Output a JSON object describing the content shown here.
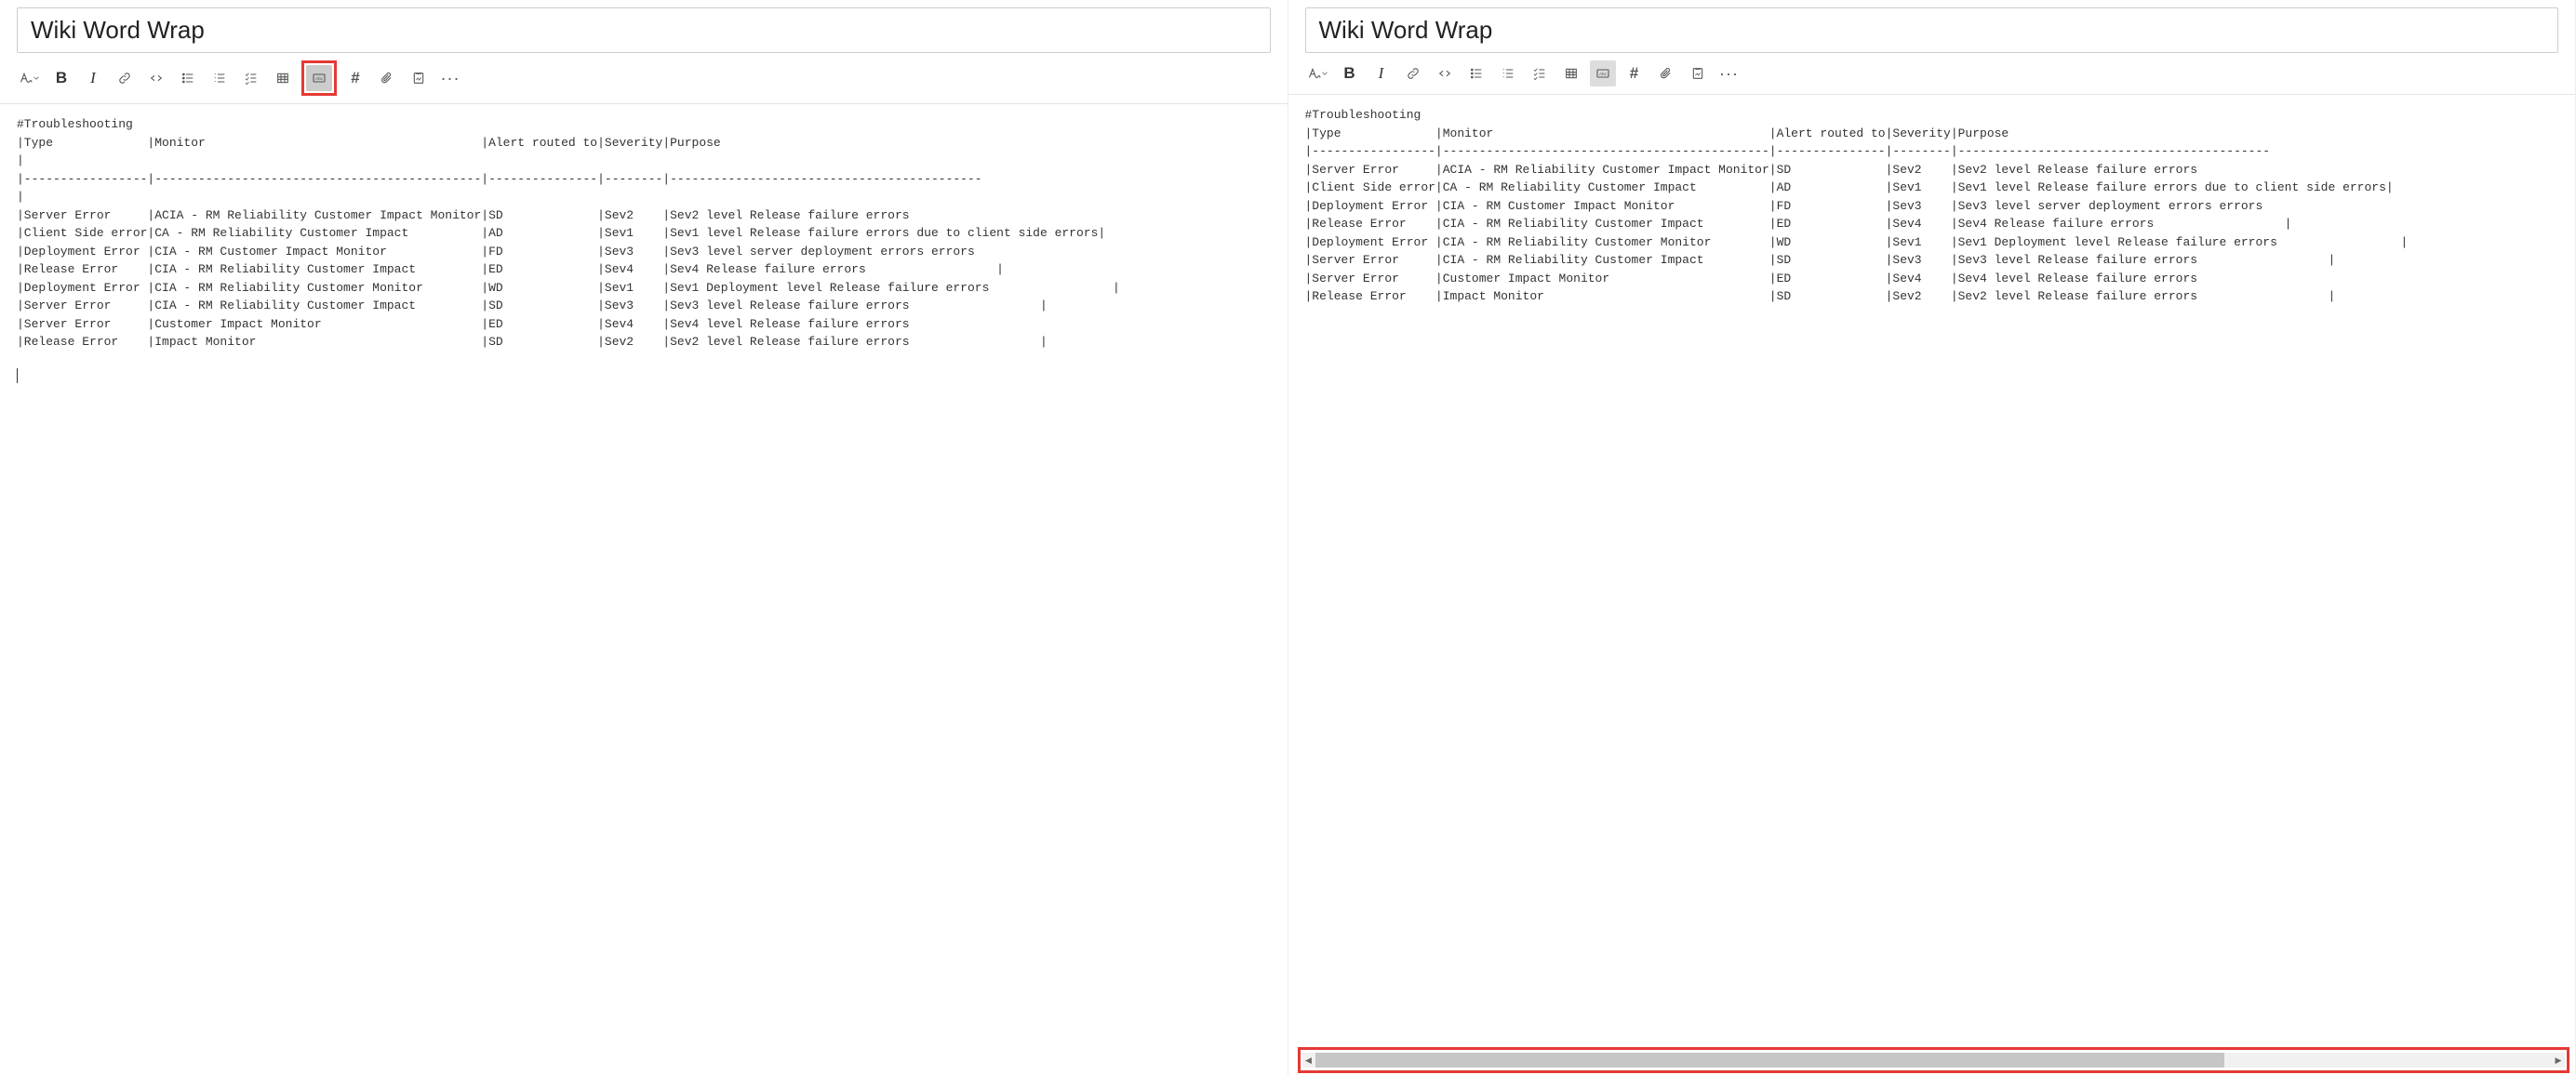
{
  "title": "Wiki Word Wrap",
  "toolbar": {
    "format_dropdown": "A",
    "bold": "B",
    "italic": "I",
    "hash": "#",
    "ellipsis": "···"
  },
  "content": {
    "heading": "#Troubleshooting",
    "header_row": "|Type             |Monitor                                      |Alert routed to|Severity|Purpose",
    "sep_row": "|-----------------|---------------------------------------------|---------------|--------|-------------------------------------------",
    "rows": [
      "|Server Error     |ACIA - RM Reliability Customer Impact Monitor|SD             |Sev2    |Sev2 level Release failure errors",
      "|Client Side error|CA - RM Reliability Customer Impact          |AD             |Sev1    |Sev1 level Release failure errors due to client side errors|",
      "|Deployment Error |CIA - RM Customer Impact Monitor             |FD             |Sev3    |Sev3 level server deployment errors errors",
      "|Release Error    |CIA - RM Reliability Customer Impact         |ED             |Sev4    |Sev4 Release failure errors                  |",
      "|Deployment Error |CIA - RM Reliability Customer Monitor        |WD             |Sev1    |Sev1 Deployment level Release failure errors                 |",
      "|Server Error     |CIA - RM Reliability Customer Impact         |SD             |Sev3    |Sev3 level Release failure errors                  |",
      "|Server Error     |Customer Impact Monitor                      |ED             |Sev4    |Sev4 level Release failure errors",
      "|Release Error    |Impact Monitor                               |SD             |Sev2    |Sev2 level Release failure errors                  |"
    ]
  }
}
